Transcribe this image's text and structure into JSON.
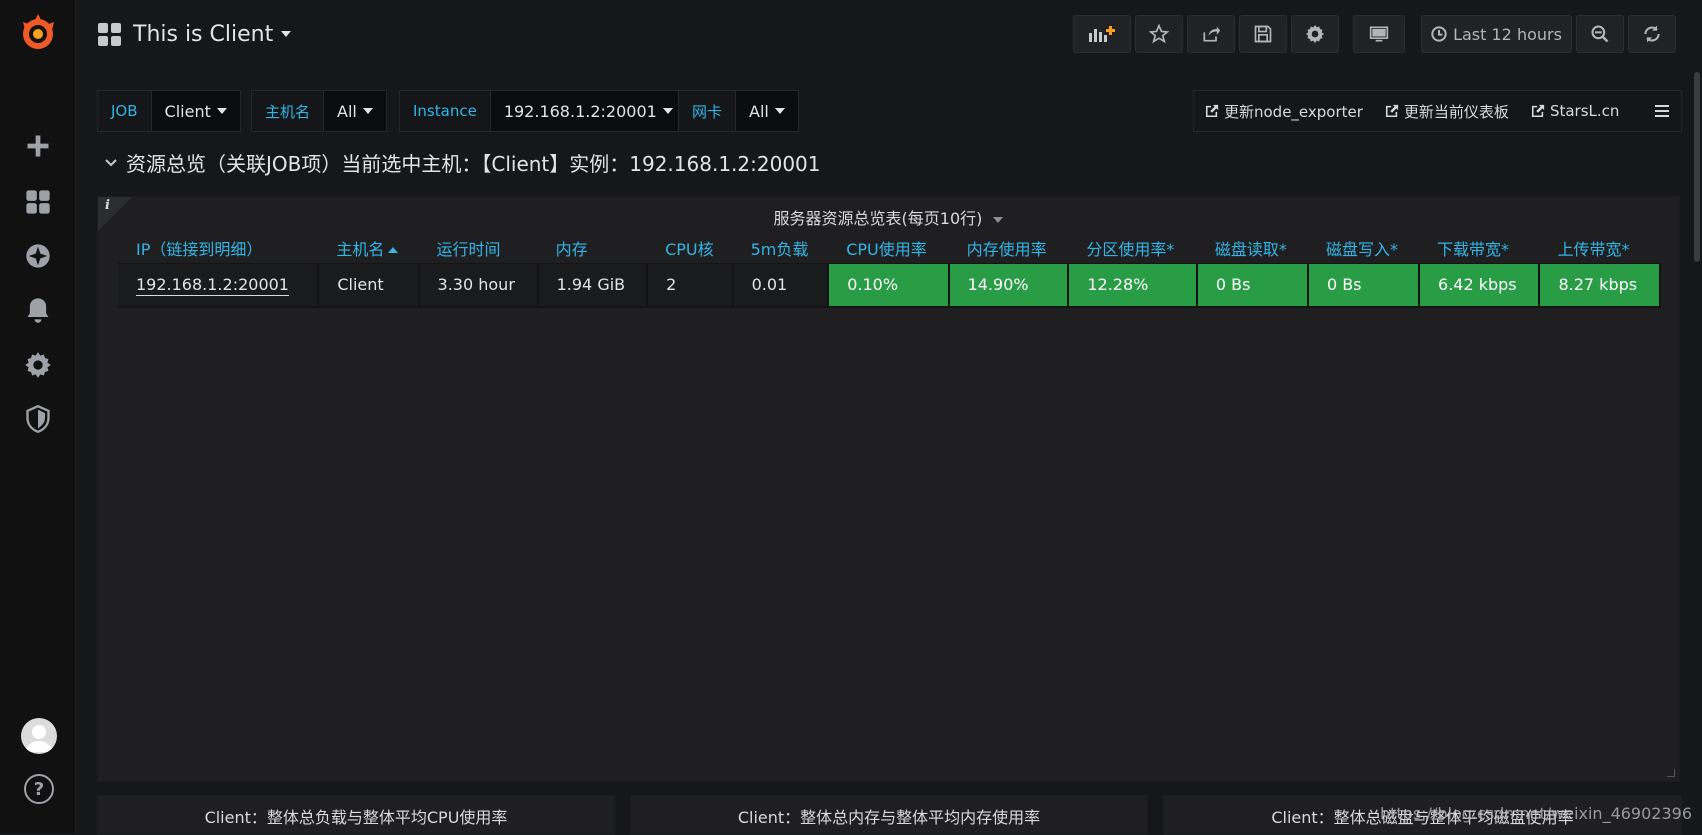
{
  "dashboard": {
    "title": "This is Client"
  },
  "toolbar": {
    "time_range": "Last 12 hours"
  },
  "variables": [
    {
      "label": "JOB",
      "value": "Client"
    },
    {
      "label": "主机名",
      "value": "All"
    },
    {
      "label": "Instance",
      "value": "192.168.1.2:20001"
    },
    {
      "label": "网卡",
      "value": "All"
    }
  ],
  "links": [
    {
      "label": "更新node_exporter"
    },
    {
      "label": "更新当前仪表板"
    },
    {
      "label": "StarsL.cn"
    }
  ],
  "row": {
    "title": "资源总览（关联JOB项）当前选中主机：【Client】实例：192.168.1.2:20001"
  },
  "panel": {
    "title": "服务器资源总览表(每页10行)",
    "columns": [
      "IP（链接到明细）",
      "主机名",
      "运行时间",
      "内存",
      "CPU核",
      "5m负载",
      "CPU使用率",
      "内存使用率",
      "分区使用率*",
      "磁盘读取*",
      "磁盘写入*",
      "下载带宽*",
      "上传带宽*"
    ],
    "rows": [
      [
        "192.168.1.2:20001",
        "Client",
        "3.30 hour",
        "1.94 GiB",
        "2",
        "0.01",
        "0.10%",
        "14.90%",
        "12.28%",
        "0 Bs",
        "0 Bs",
        "6.42 kbps",
        "8.27 kbps"
      ]
    ],
    "status_color": "#299c46"
  },
  "bottom_panels": [
    {
      "title": "Client：整体总负载与整体平均CPU使用率"
    },
    {
      "title": "Client：整体总内存与整体平均内存使用率"
    },
    {
      "title": "Client：整体总磁盘与整体平均磁盘使用率"
    }
  ],
  "watermark": "https://blog.csdn.net/weixin_46902396",
  "colors": {
    "accent": "#33b5e5",
    "ok": "#299c46",
    "background": "#161719"
  }
}
